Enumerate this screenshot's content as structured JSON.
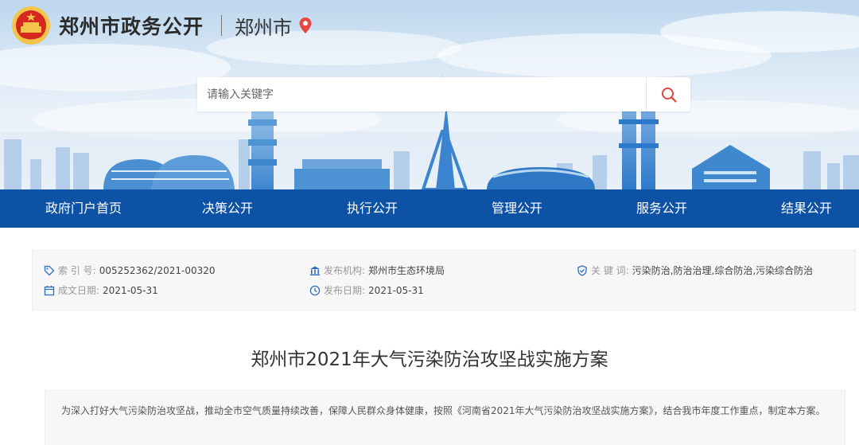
{
  "header": {
    "site_title": "郑州市政务公开",
    "city": "郑州市",
    "icons": {
      "emblem": "national-emblem-icon",
      "pin": "location-pin-icon"
    },
    "colors": {
      "pin": "#e8473f",
      "emblem_red": "#d7261e",
      "emblem_gold": "#f3c44a"
    }
  },
  "search": {
    "placeholder": "请输入关键字",
    "icon": "search-icon",
    "icon_color": "#e0453e"
  },
  "nav": {
    "background": "#0d52a4",
    "items": [
      "政府门户首页",
      "决策公开",
      "执行公开",
      "管理公开",
      "服务公开",
      "结果公开"
    ]
  },
  "meta": {
    "index_label": "索 引 号:",
    "index_value": "005252362/2021-00320",
    "org_label": "发布机构:",
    "org_value": "郑州市生态环境局",
    "keywords_label": "关 键 词:",
    "keywords_value": "污染防治,防治治理,综合防治,污染综合防治",
    "created_label": "成文日期:",
    "created_value": "2021-05-31",
    "published_label": "发布日期:",
    "published_value": "2021-05-31"
  },
  "document": {
    "title": "郑州市2021年大气污染防治攻坚战实施方案",
    "summary": "为深入打好大气污染防治攻坚战，推动全市空气质量持续改善，保障人民群众身体健康，按照《河南省2021年大气污染防治攻坚战实施方案》，结合我市年度工作重点，制定本方案。"
  }
}
